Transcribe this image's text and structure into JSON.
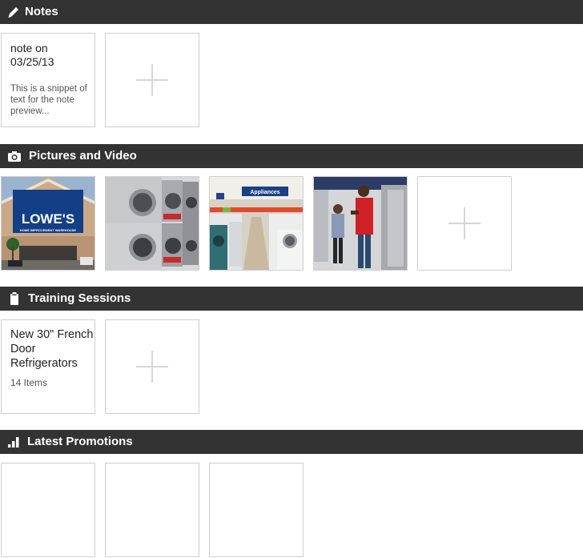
{
  "sections": {
    "notes": {
      "title": "Notes",
      "icon": "pencil-icon"
    },
    "media": {
      "title": "Pictures and Video",
      "icon": "camera-icon"
    },
    "training": {
      "title": "Training Sessions",
      "icon": "clipboard-icon"
    },
    "promotions": {
      "title": "Latest Promotions",
      "icon": "bar-chart-icon"
    }
  },
  "notes": [
    {
      "title": "note on 03/25/13",
      "snippet": "This is a snippet of text  for the note preview..."
    }
  ],
  "media": {
    "photos": [
      {
        "name": "store-front-photo",
        "sign_text": "LOWE'S",
        "sign_subtext": "HOME IMPROVEMENT WAREHOUSE"
      },
      {
        "name": "washer-dryer-stack-photo"
      },
      {
        "name": "appliance-aisle-photo",
        "sign_text": "Appliances"
      },
      {
        "name": "associate-with-customer-photo"
      }
    ]
  },
  "training": [
    {
      "title": "New 30\" French Door Refrigerators",
      "count": "14 Items"
    }
  ],
  "promotions": {
    "count": 3
  },
  "colors": {
    "header_bg": "#333333",
    "tile_border": "#cfcfcf",
    "plus": "#d6d6d6",
    "brand_blue": "#0a3a7a"
  }
}
